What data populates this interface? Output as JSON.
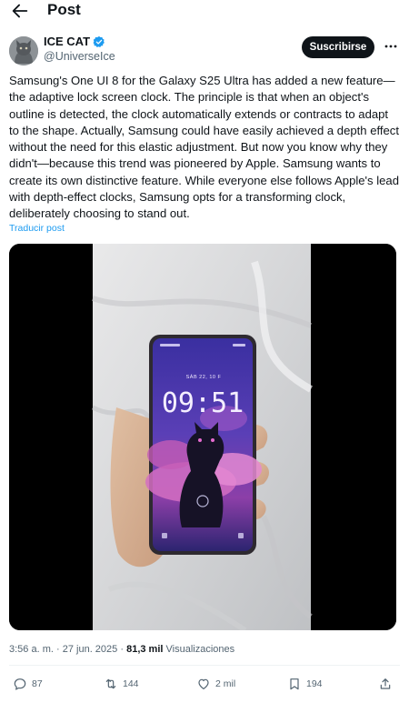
{
  "header": {
    "title": "Post"
  },
  "author": {
    "name": "ICE CAT",
    "handle": "@UniverseIce",
    "subscribe_label": "Suscribirse"
  },
  "post": {
    "text": "Samsung's One UI 8 for the Galaxy S25 Ultra has added a new feature—the adaptive lock screen clock. The principle is that when an object's outline is detected, the clock automatically extends or contracts to adapt to the shape. Actually, Samsung could have easily achieved a depth effect without the need for this elastic adjustment. But now you know why they didn't—because this trend was pioneered by Apple. Samsung wants to create its own distinctive feature. While everyone else follows Apple's lead with depth-effect clocks, Samsung opts for a transforming clock, deliberately choosing to stand out.",
    "translate_label": "Traducir post"
  },
  "media": {
    "clock_time": "09:51",
    "clock_date": "SÁB 22, 10 F"
  },
  "meta": {
    "time": "3:56 a. m.",
    "separator": "·",
    "date": "27 jun. 2025",
    "views_count": "81,3 mil",
    "views_label": "Visualizaciones"
  },
  "actions": {
    "replies": "87",
    "reposts": "144",
    "likes": "2 mil",
    "bookmarks": "194"
  },
  "colors": {
    "accent": "#1d9bf0",
    "text": "#0f1419",
    "secondary": "#536471"
  }
}
